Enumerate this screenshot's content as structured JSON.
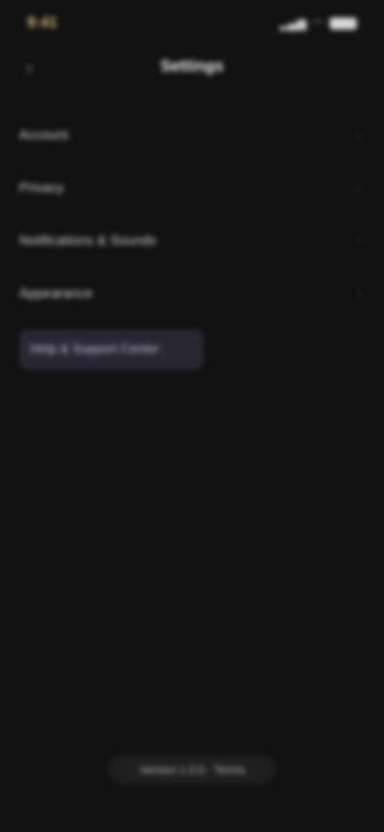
{
  "status_bar": {
    "time": "9:41",
    "signal_icon": "signal-icon",
    "wifi_icon": "wifi-icon",
    "battery_icon": "battery-icon"
  },
  "header": {
    "title": "Settings",
    "back_icon": "back-chevron-icon"
  },
  "menu": {
    "items": [
      {
        "label": "Account"
      },
      {
        "label": "Privacy"
      },
      {
        "label": "Notifications & Sounds"
      },
      {
        "label": "Appearance"
      }
    ],
    "highlight": {
      "label": "Help & Support Center"
    }
  },
  "bottom": {
    "label": "Version 1.0.0 · Terms"
  },
  "colors": {
    "background": "#121212",
    "highlight": "#2a2733",
    "accent_time": "#d8c07a"
  }
}
